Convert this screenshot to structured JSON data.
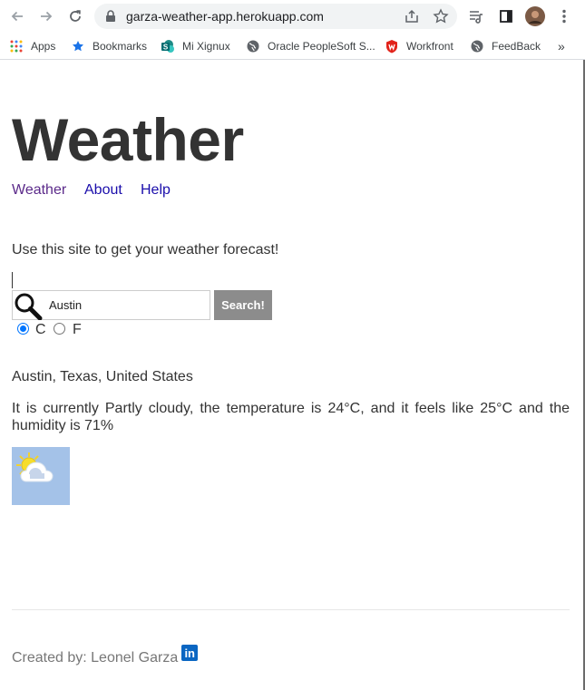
{
  "browser": {
    "url": "garza-weather-app.herokuapp.com",
    "bookmarks": [
      {
        "label": "Apps",
        "icon": "apps-grid-icon"
      },
      {
        "label": "Bookmarks",
        "icon": "star-icon"
      },
      {
        "label": "Mi Xignux",
        "icon": "sharepoint-icon"
      },
      {
        "label": "Oracle PeopleSoft S...",
        "icon": "globe-icon"
      },
      {
        "label": "Workfront",
        "icon": "workfront-icon"
      },
      {
        "label": "FeedBack",
        "icon": "globe-icon"
      }
    ],
    "overflow_glyph": "»"
  },
  "page": {
    "title": "Weather",
    "nav": [
      {
        "label": "Weather"
      },
      {
        "label": "About"
      },
      {
        "label": "Help"
      }
    ],
    "intro": "Use this site to get your weather forecast!",
    "search": {
      "value": "Austin",
      "button_label": "Search!"
    },
    "units": {
      "celsius": "C",
      "fahrenheit": "F",
      "selected": "C"
    },
    "location": "Austin, Texas, United States",
    "forecast": "It is currently Partly cloudy, the temperature is 24°C, and it feels like 25°C and the humidity is 71%",
    "weather_icon": "partly-cloudy-icon",
    "footer": {
      "credit": "Created by: Leonel Garza",
      "linkedin_icon": "linkedin-icon",
      "linkedin_text": "in"
    }
  },
  "colors": {
    "link": "#1a0dab",
    "visited_link": "#5b2a8a",
    "search_button": "#8c8c8c",
    "weather_icon_bg": "#a4c2e8",
    "linkedin": "#0a66c2"
  }
}
